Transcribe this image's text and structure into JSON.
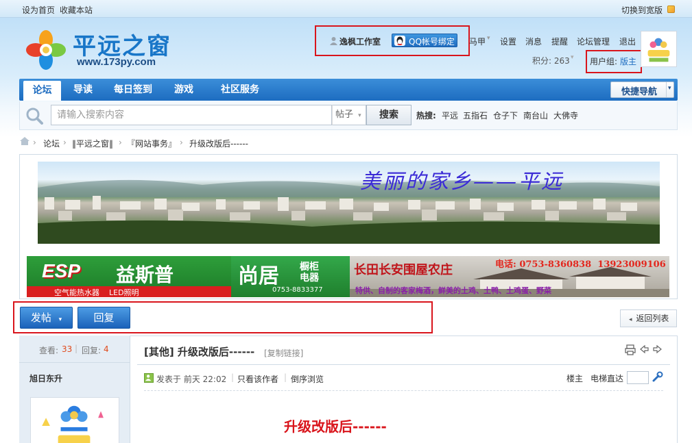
{
  "topbar": {
    "set_home": "设为首页",
    "bookmark": "收藏本站",
    "switch_width": "切换到宽版"
  },
  "logo": {
    "title": "平远之窗",
    "url": "www.173py.com"
  },
  "user": {
    "studio": "逸枫工作室",
    "qq_bind": "QQ帐号绑定",
    "links": [
      "马甲",
      "设置",
      "消息",
      "提醒",
      "论坛管理",
      "退出"
    ],
    "points_label": "积分: 263",
    "group_label": "用户组:",
    "group_value": "版主"
  },
  "nav": {
    "items": [
      "论坛",
      "导读",
      "每日签到",
      "游戏",
      "社区服务"
    ],
    "quick_nav": "快捷导航"
  },
  "search": {
    "placeholder": "请输入搜索内容",
    "type": "帖子",
    "button": "搜索",
    "hot_label": "热搜:",
    "hot": [
      "平远",
      "五指石",
      "仓子下",
      "南台山",
      "大佛寺"
    ]
  },
  "breadcrumb": {
    "items": [
      "论坛",
      "‖平远之窗‖",
      "『网站事务』",
      "升级改版后------"
    ],
    "sep": "›"
  },
  "banners": {
    "scenic_text": "美丽的家乡——平远",
    "ad1_brand_en": "ESP",
    "ad1_brand_cn": "益斯普",
    "ad1_tagline": "空气能热水器    LED照明",
    "ad2_brand": "尚居",
    "ad2_sub": "橱柜电器",
    "ad2_phone": "0753-8833377",
    "ad3_title": "长田长安围屋农庄",
    "ad3_phone": "电话: 0753-8360838  13923009106",
    "ad3_desc": "特供、自制的客家梅酒，鲜美的土鸡、土鸭、土鸡蛋、野菜"
  },
  "actions": {
    "post": "发帖",
    "reply": "回复",
    "back": "返回列表"
  },
  "thread": {
    "views_label": "查看:",
    "views": "33",
    "replies_label": "回复:",
    "replies": "4",
    "title": "[其他] 升级改版后------",
    "copy_link": "[复制链接]",
    "author": "旭日东升",
    "posted": "发表于 前天 22:02",
    "only_author": "只看该作者",
    "reverse": "倒序浏览",
    "floor": "楼主",
    "jump_label": "电梯直达",
    "body": "升级改版后------"
  },
  "colors": {
    "accent": "#1d6cc0",
    "highlight_box": "#d9141b",
    "count_red": "#e04a1c"
  }
}
